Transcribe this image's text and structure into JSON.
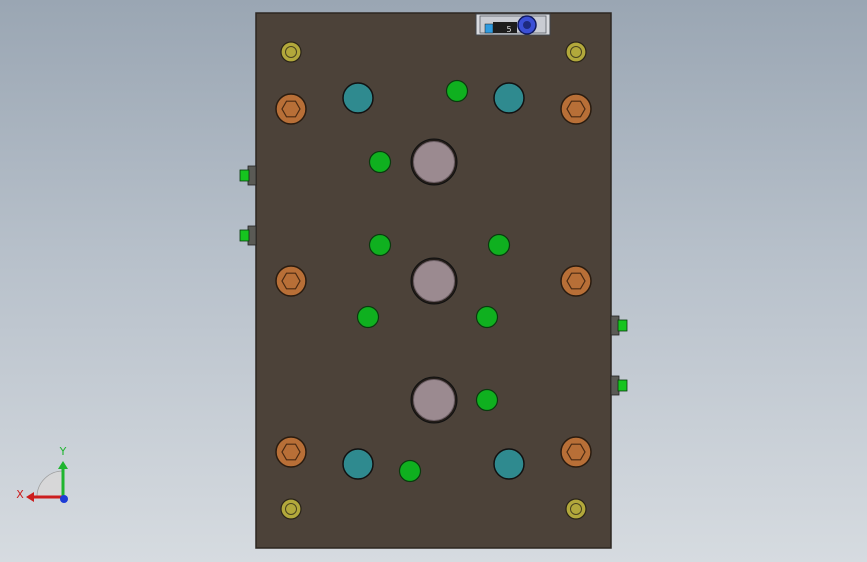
{
  "viewport": {
    "background_top": "#9aa6b3",
    "background_bottom": "#d6dbe0"
  },
  "model": {
    "plate_color": "#4c4239",
    "plate_edge_color": "#2c2621",
    "port_large_color": "#9b8a90",
    "port_teal_color": "#2f8a8f",
    "port_green_color": "#0fb01f",
    "bolt_head_color": "#b86f37",
    "dowel_color": "#b2a83b",
    "fitting_color": "#16c41f",
    "top_component_color": "#3a4fd6",
    "top_component_label": "5"
  },
  "triad": {
    "x_label": "X",
    "y_label": "Y",
    "x_color": "#cc1e1e",
    "y_color": "#1fb52f",
    "z_color": "#1d3cd6"
  }
}
